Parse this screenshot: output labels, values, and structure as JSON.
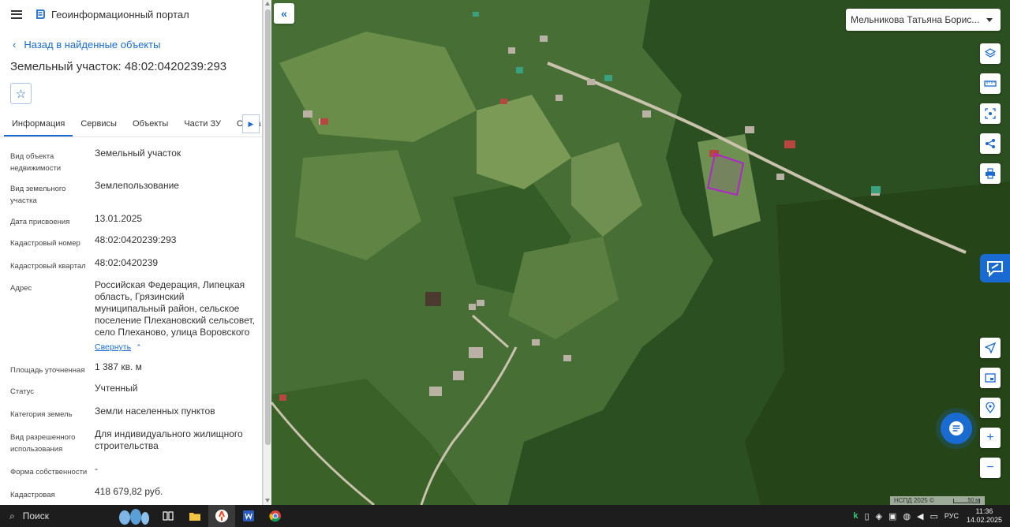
{
  "header": {
    "title": "Геоинформационный портал"
  },
  "back_link": "Назад в найденные объекты",
  "object_title": "Земельный участок: 48:02:0420239:293",
  "tabs": [
    "Информация",
    "Сервисы",
    "Объекты",
    "Части ЗУ",
    "Соста"
  ],
  "props": {
    "type": {
      "label": "Вид объекта недвижимости",
      "value": "Земельный участок"
    },
    "land_kind": {
      "label": "Вид земельного участка",
      "value": "Землепользование"
    },
    "assigned": {
      "label": "Дата присвоения",
      "value": "13.01.2025"
    },
    "cad_number": {
      "label": "Кадастровый номер",
      "value": "48:02:0420239:293"
    },
    "cad_quarter": {
      "label": "Кадастровый квартал",
      "value": "48:02:0420239"
    },
    "address": {
      "label": "Адрес",
      "value": "Российская Федерация, Липецкая область, Грязинский муниципальный район, сельское поселение Плехановский сельсовет, село Плеханово, улица Воровского",
      "collapse": "Свернуть"
    },
    "area": {
      "label": "Площадь уточненная",
      "value": "1 387 кв. м"
    },
    "status": {
      "label": "Статус",
      "value": "Учтенный"
    },
    "category": {
      "label": "Категория земель",
      "value": "Земли населенных пунктов"
    },
    "permitted_use": {
      "label": "Вид разрешенного использования",
      "value": "Для индивидуального жилищного строительства"
    },
    "ownership": {
      "label": "Форма собственности",
      "value": "-"
    },
    "cad_value": {
      "label": "Кадастровая стоимость",
      "value": "418 679,82 руб."
    }
  },
  "map": {
    "user": "Мельникова Татьяна Борис...",
    "attribution": "НСПД 2025 ©",
    "scale": "50 м"
  },
  "taskbar": {
    "search": "Поиск",
    "lang": "РУС",
    "time": "11:36",
    "date": "14.02.2025"
  },
  "colors": {
    "accent": "#1a6bd1",
    "parcel": "#b026c9"
  }
}
